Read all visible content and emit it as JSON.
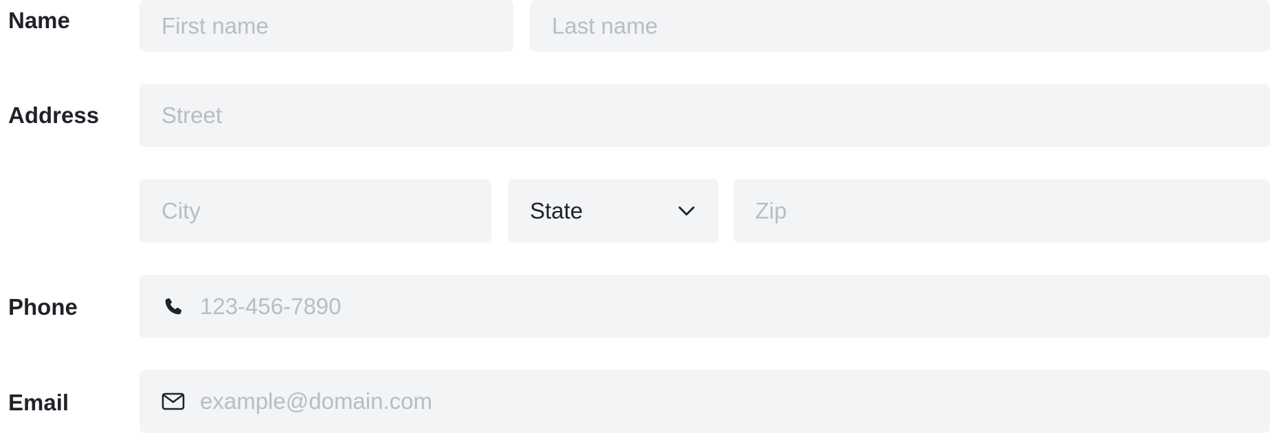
{
  "name": {
    "label": "Name",
    "first_placeholder": "First name",
    "last_placeholder": "Last name"
  },
  "address": {
    "label": "Address",
    "street_placeholder": "Street",
    "city_placeholder": "City",
    "state_value": "State",
    "zip_placeholder": "Zip"
  },
  "phone": {
    "label": "Phone",
    "placeholder": "123-456-7890",
    "icon": "phone-icon"
  },
  "email": {
    "label": "Email",
    "placeholder": "example@domain.com",
    "icon": "mail-icon"
  },
  "colors": {
    "field_bg": "#f3f4f6",
    "placeholder": "#b8bcc4",
    "label": "#1f2328"
  }
}
